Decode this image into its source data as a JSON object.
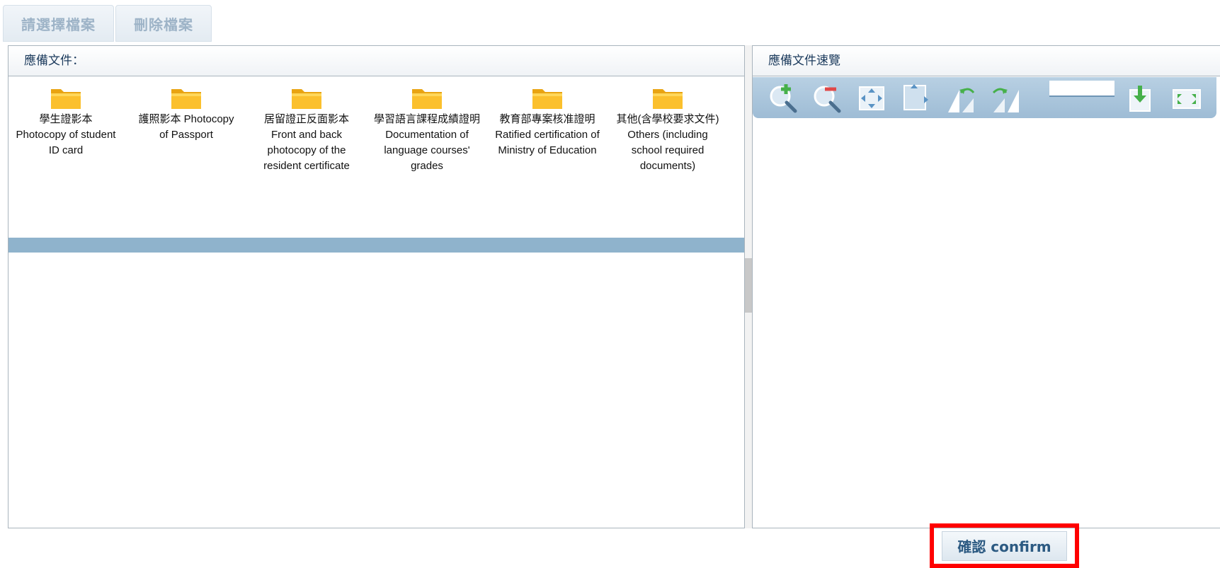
{
  "toolbar": {
    "select_file_label": "請選擇檔案",
    "delete_file_label": "刪除檔案"
  },
  "left_panel": {
    "title": "應備文件：",
    "folders": [
      {
        "label": "學生證影本 Photocopy of student ID card",
        "icon": "folder-icon"
      },
      {
        "label": "護照影本 Photocopy of Passport",
        "icon": "folder-icon"
      },
      {
        "label": "居留證正反面影本 Front and back photocopy of the resident certificate",
        "icon": "folder-icon"
      },
      {
        "label": "學習語言課程成績證明 Documentation of language courses' grades",
        "icon": "folder-icon"
      },
      {
        "label": "教育部專案核准證明 Ratified certification of Ministry of Education",
        "icon": "folder-icon"
      },
      {
        "label": "其他(含學校要求文件) Others (including school required documents)",
        "icon": "folder-icon"
      }
    ]
  },
  "right_panel": {
    "title": "應備文件速覽",
    "tools": [
      "zoom-in-icon",
      "zoom-out-icon",
      "fit-page-icon",
      "fit-width-icon",
      "rotate-left-icon",
      "rotate-right-icon",
      "download-icon",
      "fullscreen-icon"
    ],
    "page_input_value": ""
  },
  "confirm": {
    "label": "確認 confirm"
  },
  "colors": {
    "accent": "#8fb3cc",
    "toolbar": "#a9c4db",
    "highlight": "#ff0000",
    "folder": "#f7b520"
  }
}
